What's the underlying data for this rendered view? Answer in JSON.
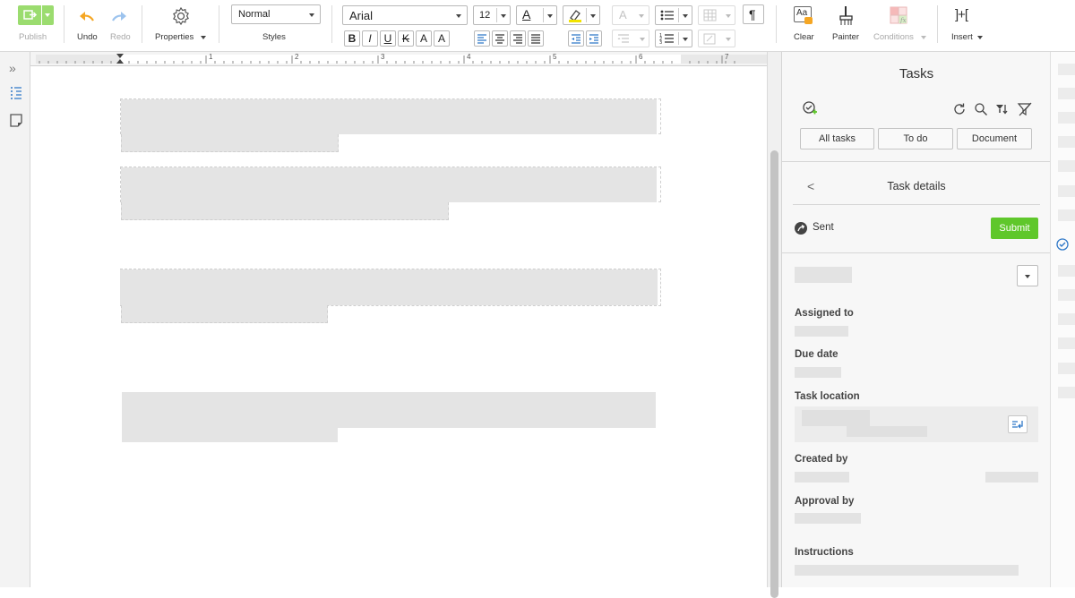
{
  "toolbar": {
    "publish_label": "Publish",
    "undo_label": "Undo",
    "redo_label": "Redo",
    "properties_label": "Properties",
    "style_value": "Normal",
    "styles_label": "Styles",
    "font_value": "Arial",
    "font_size_value": "12",
    "clear_label": "Clear",
    "painter_label": "Painter",
    "conditions_label": "Conditions",
    "insert_label": "Insert",
    "format_buttons": [
      "B",
      "I",
      "U",
      "K",
      "A",
      "A"
    ],
    "pilcrow": "¶",
    "insert_glyph": "]+[",
    "clear_glyph": "Aa",
    "accent_color": "#7ed321",
    "undo_color": "#f5a623",
    "redo_color": "#4a90e2"
  },
  "ruler": {
    "numbers": [
      "1",
      "2",
      "3",
      "4",
      "5",
      "6",
      "7"
    ]
  },
  "tasks_panel": {
    "title": "Tasks",
    "filters": [
      "All tasks",
      "To do",
      "Document"
    ],
    "details_title": "Task details",
    "back_glyph": "<",
    "status_text": "Sent",
    "submit_label": "Submit",
    "submit_color": "#5fc72b",
    "fields": {
      "assigned_to": "Assigned to",
      "due_date": "Due date",
      "task_location": "Task location",
      "created_by": "Created by",
      "approval_by": "Approval by",
      "instructions": "Instructions"
    }
  },
  "left_rail": {
    "expand_glyph": "»"
  }
}
